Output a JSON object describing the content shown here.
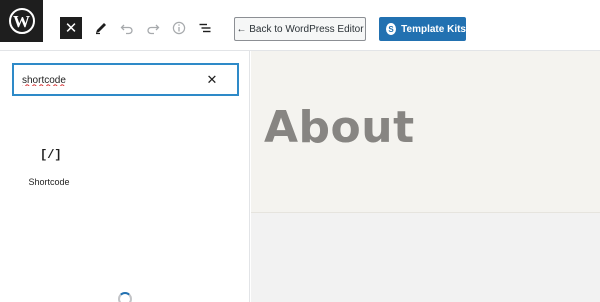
{
  "toolbar": {
    "logo": "W",
    "close_glyph": "✕",
    "back_label": "← Back to WordPress Editor",
    "template_kits_label": "Template Kits",
    "template_kits_badge": "S",
    "accent": "#2271b1"
  },
  "inserter": {
    "search_value": "shortcode",
    "clear_glyph": "✕",
    "results": [
      {
        "icon": "[/]",
        "label": "Shortcode"
      }
    ]
  },
  "canvas": {
    "title": "About"
  }
}
